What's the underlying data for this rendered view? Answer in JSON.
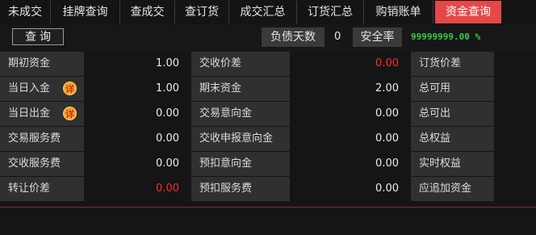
{
  "tabs": [
    {
      "label": "未成交",
      "active": false
    },
    {
      "label": "挂牌查询",
      "active": false
    },
    {
      "label": "查成交",
      "active": false
    },
    {
      "label": "查订货",
      "active": false
    },
    {
      "label": "成交汇总",
      "active": false
    },
    {
      "label": "订货汇总",
      "active": false
    },
    {
      "label": "购销账单",
      "active": false
    },
    {
      "label": "资金查询",
      "active": true
    }
  ],
  "toolbar": {
    "query_label": "查询",
    "debt_days_label": "负债天数",
    "debt_days_value": "0",
    "safety_rate_label": "安全率",
    "safety_rate_value": "99999999.00 %"
  },
  "rows": [
    {
      "c1_label": "期初资金",
      "c1_value": "1.00",
      "c2_label": "交收价差",
      "c2_value": "0.00",
      "c3_label": "订货价差",
      "c3_value": ""
    },
    {
      "c1_label": "当日入金",
      "c1_value": "1.00",
      "c2_label": "期末资金",
      "c2_value": "2.00",
      "c3_label": "总可用",
      "c3_value": ""
    },
    {
      "c1_label": "当日出金",
      "c1_value": "0.00",
      "c2_label": "交易意向金",
      "c2_value": "0.00",
      "c3_label": "总可出",
      "c3_value": ""
    },
    {
      "c1_label": "交易服务费",
      "c1_value": "0.00",
      "c2_label": "交收申报意向金",
      "c2_value": "0.00",
      "c3_label": "总权益",
      "c3_value": ""
    },
    {
      "c1_label": "交收服务费",
      "c1_value": "0.00",
      "c2_label": "预扣意向金",
      "c2_value": "0.00",
      "c3_label": "实时权益",
      "c3_value": ""
    },
    {
      "c1_label": "转让价差",
      "c1_value": "0.00",
      "c2_label": "预扣服务费",
      "c2_value": "0.00",
      "c3_label": "应追加资金",
      "c3_value": ""
    }
  ],
  "detail_badge": "详",
  "colors": {
    "active_tab": "#e54848",
    "negative_value": "#ff2b2b",
    "safety_rate": "#3fc94a"
  }
}
